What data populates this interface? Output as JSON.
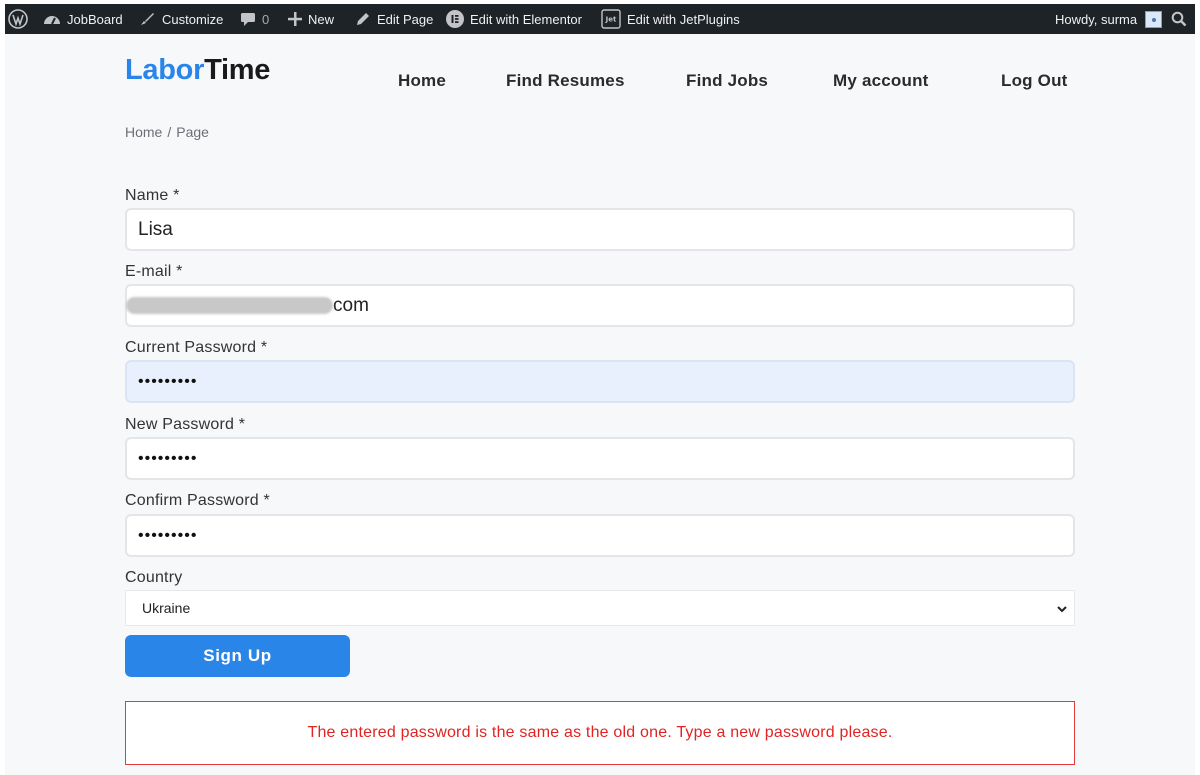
{
  "adminbar": {
    "site_name": "JobBoard",
    "customize": "Customize",
    "comments_count": "0",
    "new": "New",
    "edit_page": "Edit Page",
    "edit_elementor": "Edit with Elementor",
    "edit_jet": "Edit with JetPlugins",
    "howdy": "Howdy, surma"
  },
  "logo": {
    "part1": "Labor",
    "part2": "Time"
  },
  "nav": {
    "home": "Home",
    "find_resumes": "Find Resumes",
    "find_jobs": "Find Jobs",
    "my_account": "My account",
    "log_out": "Log Out"
  },
  "breadcrumb": {
    "home": "Home",
    "separator": "/",
    "current": "Page"
  },
  "form": {
    "name_label": "Name *",
    "name_value": "Lisa",
    "email_label": "E-mail *",
    "email_value_suffix": "com",
    "current_password_label": "Current Password *",
    "current_password_value": "•••••••••",
    "new_password_label": "New Password *",
    "new_password_value": "•••••••••",
    "confirm_password_label": "Confirm Password *",
    "confirm_password_value": "•••••••••",
    "country_label": "Country",
    "country_value": "Ukraine",
    "submit_label": "Sign Up"
  },
  "error_message": "The entered password is the same as the old one. Type a new password please.",
  "colors": {
    "brand": "#2a85e8",
    "error": "#e02424",
    "adminbar": "#1d2327"
  }
}
